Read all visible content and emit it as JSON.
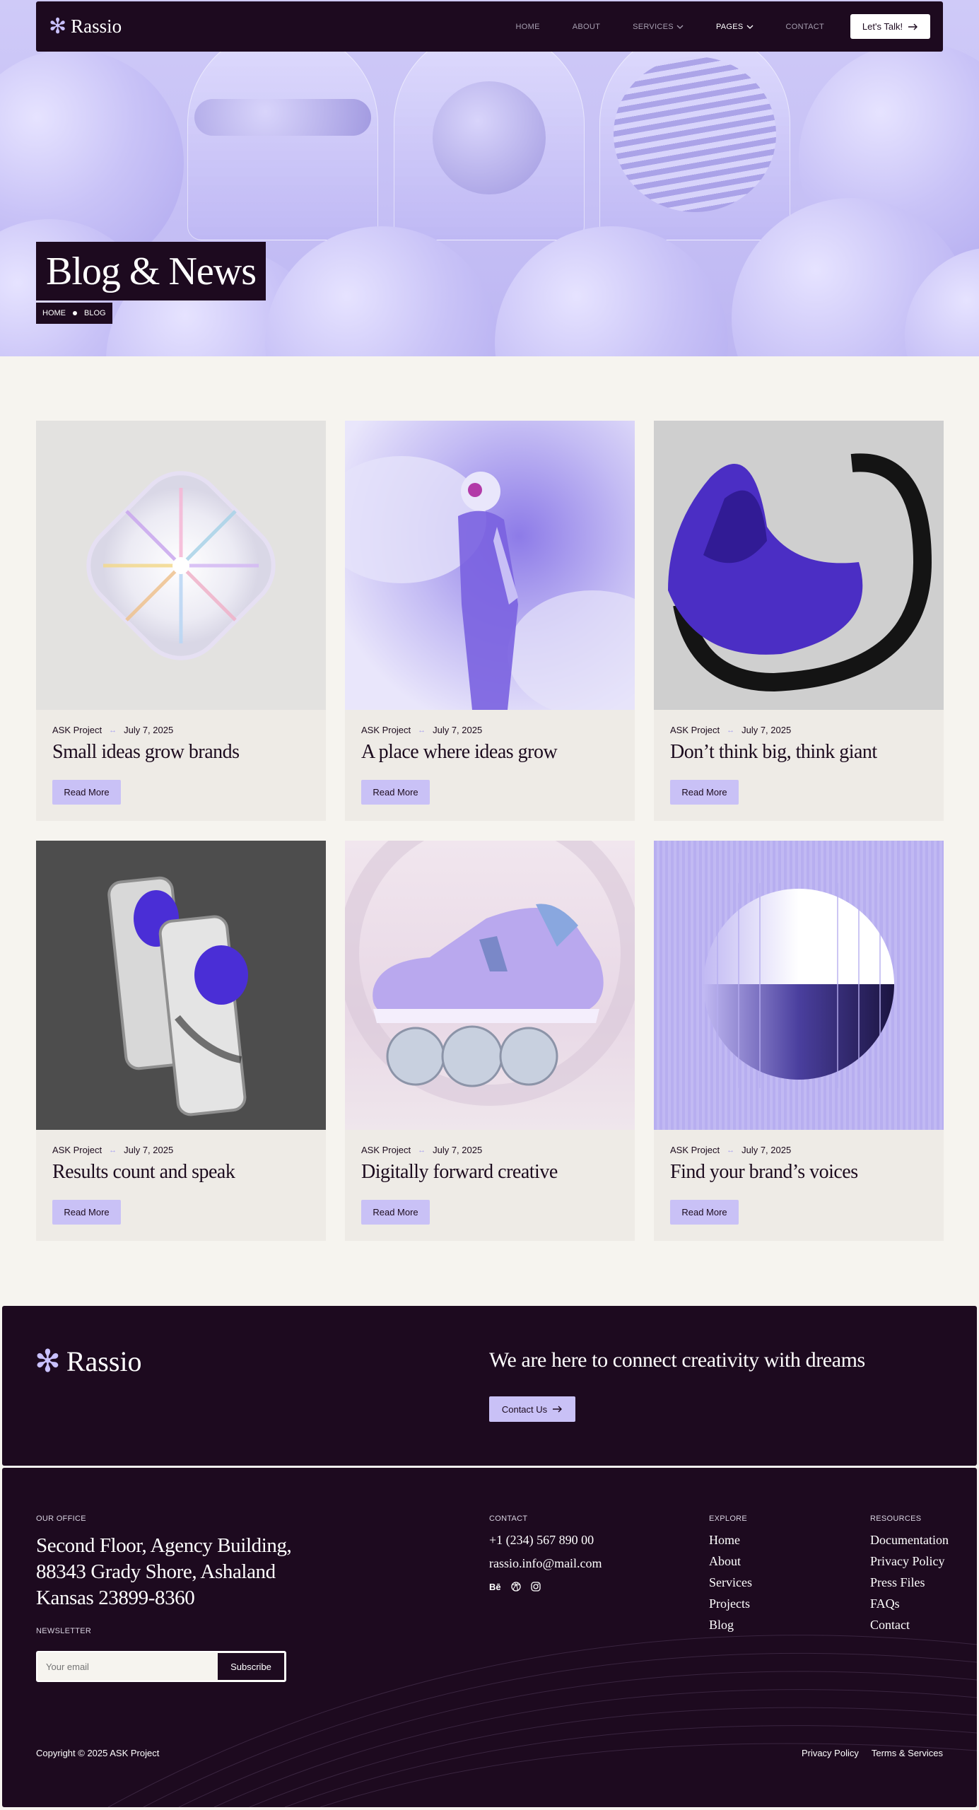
{
  "nav": {
    "logo_text": "Rassio",
    "links": [
      {
        "label": "HOME"
      },
      {
        "label": "ABOUT"
      },
      {
        "label": "SERVICES"
      },
      {
        "label": "PAGES"
      },
      {
        "label": "CONTACT"
      }
    ],
    "cta_label": "Let's Talk!"
  },
  "hero": {
    "title": "Blog & News",
    "breadcrumb": [
      "HOME",
      "BLOG"
    ]
  },
  "posts": [
    {
      "author": "ASK Project",
      "date": "July 7, 2025",
      "title": "Small ideas grow brands",
      "button": "Read More"
    },
    {
      "author": "ASK Project",
      "date": "July 7, 2025",
      "title": "A place where ideas grow",
      "button": "Read More"
    },
    {
      "author": "ASK Project",
      "date": "July 7, 2025",
      "title": "Don’t think big, think giant",
      "button": "Read More"
    },
    {
      "author": "ASK Project",
      "date": "July 7, 2025",
      "title": "Results count and speak",
      "button": "Read More"
    },
    {
      "author": "ASK Project",
      "date": "July 7, 2025",
      "title": "Digitally forward creative",
      "button": "Read More"
    },
    {
      "author": "ASK Project",
      "date": "July 7, 2025",
      "title": "Find your brand’s voices",
      "button": "Read More"
    }
  ],
  "cta": {
    "logo_text": "Rassio",
    "tagline": "We are here to connect creativity with dreams",
    "button": "Contact Us"
  },
  "footer": {
    "office_label": "OUR OFFICE",
    "address": [
      "Second Floor, Agency Building,",
      "88343 Grady Shore, Ashaland",
      "Kansas 23899-8360"
    ],
    "newsletter_label": "NEWSLETTER",
    "newsletter_placeholder": "Your email",
    "subscribe_label": "Subscribe",
    "contact_label": "CONTACT",
    "phone": "+1 (234) 567 890 00",
    "email": "rassio.info@mail.com",
    "social": [
      "Bē",
      "dribbble-icon",
      "instagram-icon"
    ],
    "explore_label": "EXPLORE",
    "explore": [
      "Home",
      "About",
      "Services",
      "Projects",
      "Blog"
    ],
    "resources_label": "RESOURCES",
    "resources": [
      "Documentation",
      "Privacy Policy",
      "Press Files",
      "FAQs",
      "Contact"
    ],
    "copyright": "Copyright © 2025 ASK Project",
    "legal": [
      "Privacy Policy",
      "Terms & Services"
    ]
  },
  "colors": {
    "dark": "#1d0a1f",
    "accent": "#c9c1f6",
    "background": "#f6f4ef",
    "card": "#eeebe6"
  }
}
